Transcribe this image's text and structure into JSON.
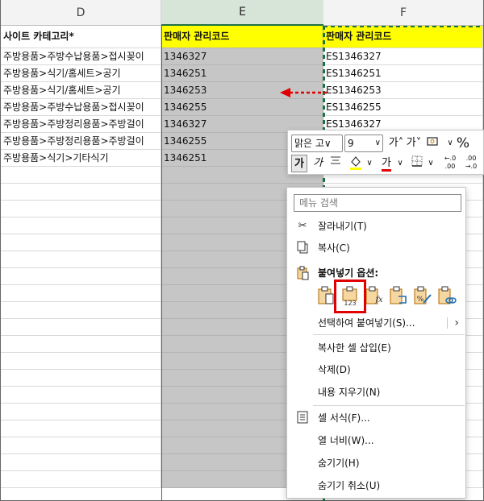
{
  "columns": {
    "d": "D",
    "e": "E",
    "f": "F"
  },
  "header_row": {
    "d": "사이트 카테고리*",
    "e": "판매자 관리코드",
    "f": "판매자 관리코드"
  },
  "rows": [
    {
      "d": "주방용품>주방수납용품>접시꽂이",
      "e": "1346327",
      "f": "ES1346327"
    },
    {
      "d": "주방용품>식기/홈세트>공기",
      "e": "1346251",
      "f": "ES1346251"
    },
    {
      "d": "주방용품>식기/홈세트>공기",
      "e": "1346253",
      "f": "ES1346253"
    },
    {
      "d": "주방용품>주방수납용품>접시꽂이",
      "e": "1346255",
      "f": "ES1346255"
    },
    {
      "d": "주방용품>주방정리용품>주방걸이",
      "e": "1346327",
      "f": "ES1346327"
    },
    {
      "d": "주방용품>주방정리용품>주방걸이",
      "e": "1346255",
      "f": ""
    },
    {
      "d": "주방용품>식기>기타식기",
      "e": "1346251",
      "f": ""
    }
  ],
  "mini_toolbar": {
    "font_name": "맑은 고∨",
    "font_size": "9",
    "increase_font": "가˄",
    "decrease_font": "가˅",
    "percent": "%",
    "bold": "가",
    "italic": "가",
    "font_color_glyph": "가",
    "decimal_inc": "←.0\n.00",
    "decimal_dec": ".00\n→.0"
  },
  "context_menu": {
    "search_placeholder": "메뉴 검색",
    "cut": "잘라내기(T)",
    "copy": "복사(C)",
    "paste_options_title": "붙여넣기 옵션:",
    "paste_special": "선택하여 붙여넣기(S)...",
    "insert_copied": "복사한 셀 삽입(E)",
    "delete": "삭제(D)",
    "clear": "내용 지우기(N)",
    "format_cells": "셀 서식(F)...",
    "column_width": "열 너비(W)...",
    "hide": "숨기기(H)",
    "unhide": "숨기기 취소(U)"
  },
  "paste_icon_labels": {
    "values": "123",
    "formula": "fx"
  },
  "colors": {
    "highlight_yellow": "#ffff00",
    "selected_gray": "#c6c6c6",
    "accent_green": "#1e7145",
    "red": "#e00000"
  }
}
